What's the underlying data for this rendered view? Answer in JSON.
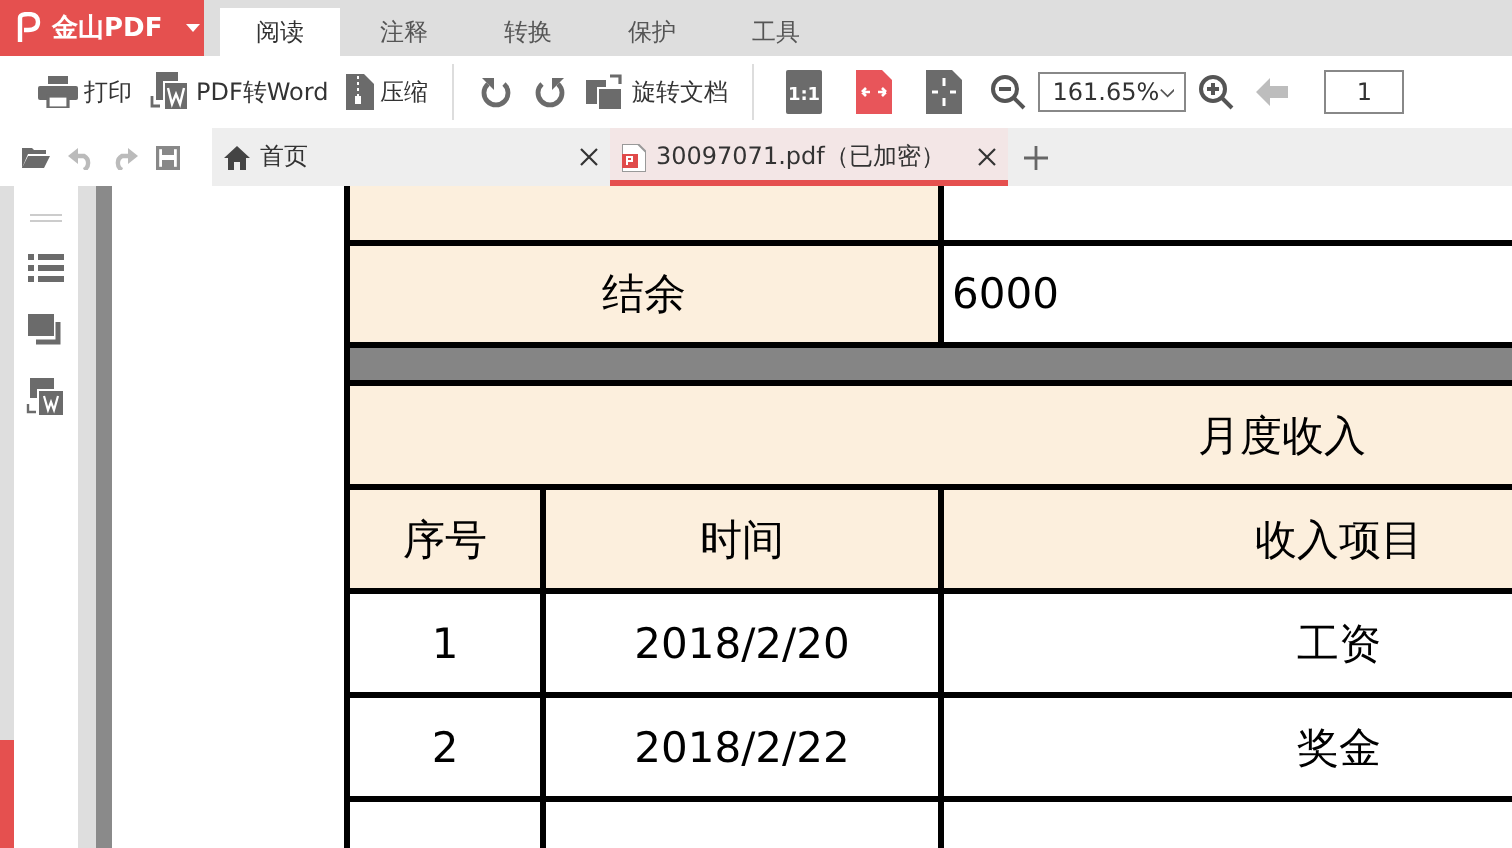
{
  "app": {
    "name": "金山PDF"
  },
  "menu_tabs": [
    {
      "label": "阅读",
      "selected": true
    },
    {
      "label": "注释",
      "selected": false
    },
    {
      "label": "转换",
      "selected": false
    },
    {
      "label": "保护",
      "selected": false
    },
    {
      "label": "工具",
      "selected": false
    }
  ],
  "toolbar": {
    "actions": [
      {
        "kind": "print",
        "label": "打印"
      },
      {
        "kind": "convert",
        "label": "PDF转Word"
      },
      {
        "kind": "compress",
        "label": "压缩"
      },
      {
        "kind": "rotate-left"
      },
      {
        "kind": "rotate-right"
      },
      {
        "kind": "rotate-doc",
        "label": "旋转文档"
      }
    ],
    "view_modes": [
      {
        "kind": "actual",
        "label": "1:1",
        "selected": false
      },
      {
        "kind": "fit-width",
        "selected": true
      },
      {
        "kind": "fit-page",
        "selected": false
      }
    ],
    "zoom": {
      "value": "161.65%"
    },
    "previous_disabled": true,
    "page": {
      "value": "1"
    }
  },
  "doc_tabs": [
    {
      "kind": "home",
      "title": "首页",
      "selected": false
    },
    {
      "kind": "pdf",
      "title": "30097071.pdf（已加密）",
      "selected": true
    }
  ],
  "table": {
    "summary_rows": [
      {
        "label": "结余",
        "value": "6000"
      }
    ],
    "section_title": "月度收入",
    "columns": [
      "序号",
      "时间",
      "收入项目"
    ],
    "rows": [
      [
        "1",
        "2018/2/20",
        "工资"
      ],
      [
        "2",
        "2018/2/22",
        "奖金"
      ]
    ]
  }
}
